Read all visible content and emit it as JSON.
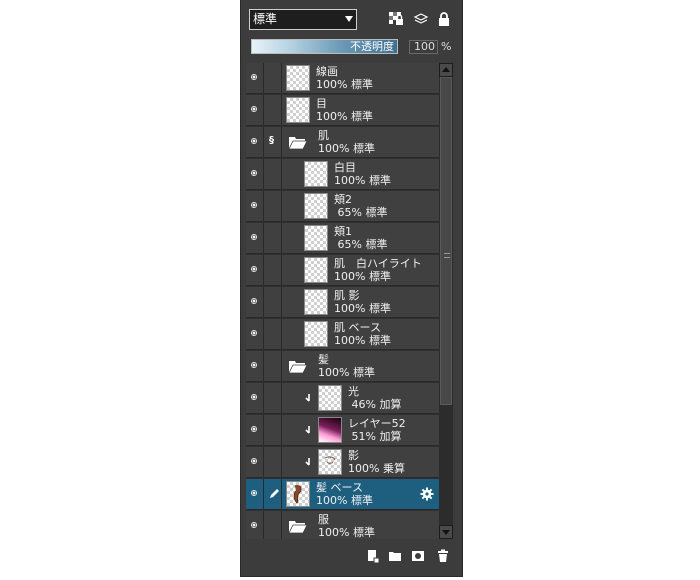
{
  "toolbar": {
    "blend_mode": "標準",
    "icons": [
      "lock-transparency-icon",
      "layers-stack-icon",
      "lock-icon"
    ]
  },
  "opacity": {
    "label": "不透明度",
    "value": "100",
    "unit": "%",
    "fill": 1.0
  },
  "layers": [
    {
      "name": "線画",
      "mode": "100% 標準",
      "type": "layer",
      "indent": 0
    },
    {
      "name": "目",
      "mode": "100% 標準",
      "type": "layer",
      "indent": 0
    },
    {
      "name": "肌",
      "mode": "100% 標準",
      "type": "folder",
      "indent": 0,
      "flag": "§"
    },
    {
      "name": "白目",
      "mode": "100% 標準",
      "type": "layer",
      "indent": 1
    },
    {
      "name": "頬2",
      "mode": " 65% 標準",
      "type": "layer",
      "indent": 1
    },
    {
      "name": "頬1",
      "mode": " 65% 標準",
      "type": "layer",
      "indent": 1
    },
    {
      "name": "肌　白ハイライト",
      "mode": "100% 標準",
      "type": "layer",
      "indent": 1
    },
    {
      "name": "肌 影",
      "mode": "100% 標準",
      "type": "layer",
      "indent": 1
    },
    {
      "name": "肌 ベース",
      "mode": "100% 標準",
      "type": "layer",
      "indent": 1
    },
    {
      "name": "髪",
      "mode": "100% 標準",
      "type": "folder",
      "indent": 0
    },
    {
      "name": "光",
      "mode": " 46% 加算",
      "type": "layer",
      "indent": 1,
      "clipped": true
    },
    {
      "name": "レイヤー52",
      "mode": " 51% 加算",
      "type": "layer",
      "indent": 1,
      "clipped": true,
      "thumb": "gradient"
    },
    {
      "name": "影",
      "mode": "100% 乗算",
      "type": "layer",
      "indent": 1,
      "clipped": true,
      "thumb": "sketch"
    },
    {
      "name": "髪 ベース",
      "mode": "100% 標準",
      "type": "layer",
      "indent": 0,
      "selected": true,
      "editing": true,
      "thumb": "hair"
    },
    {
      "name": "服",
      "mode": "100% 標準",
      "type": "folder",
      "indent": 0
    }
  ],
  "bottom": {
    "icons": [
      "new-layer-icon",
      "new-folder-icon",
      "mask-icon",
      "trash-icon"
    ]
  },
  "colors": {
    "panel": "#3c3c3c",
    "selected": "#1e5f80",
    "row": "#404040"
  }
}
